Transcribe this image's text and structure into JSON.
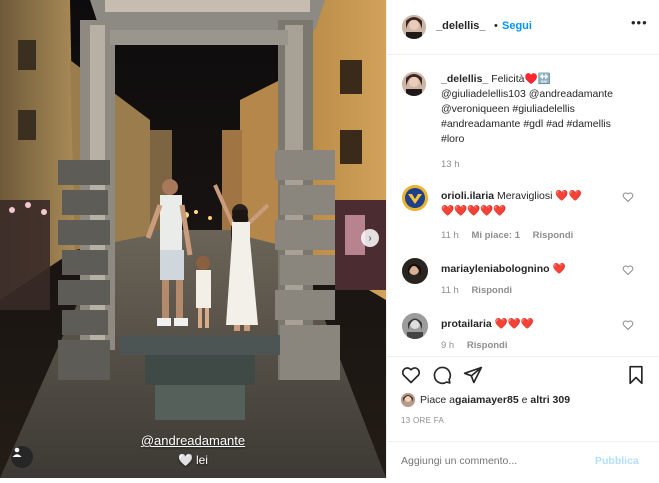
{
  "post": {
    "author": "_delellis_",
    "follow_label": "Segui",
    "dot": "•",
    "more_label": "•••"
  },
  "photo": {
    "overlay_mention": "@andreadamante",
    "overlay_heart": "🤍",
    "overlay_lei": "lei",
    "next_arrow": "›"
  },
  "caption": {
    "author": "_delellis_",
    "line1_text": " Felicità♥️🔛",
    "line2": "@giuliadelellis103 @andreadamante",
    "line3": "@veroniqueen #giuliadelellis",
    "line4": "#andreadamante #gdl #ad #damellis",
    "line5": "#loro",
    "time": "13 h"
  },
  "comments": [
    {
      "user": "orioli.ilaria",
      "text": " Meravigliosi ❤️❤️",
      "text2": "❤️❤️❤️❤️❤️",
      "time": "11 h",
      "likes": "Mi piace: 1",
      "reply": "Rispondi"
    },
    {
      "user": "mariaylenia bolognino",
      "user_display": "mariayleniabolognino",
      "text": " ❤️",
      "time": "11 h",
      "reply": "Rispondi"
    },
    {
      "user": "protailaria",
      "text": " ❤️❤️❤️",
      "time": "9 h",
      "reply": "Rispondi"
    }
  ],
  "likes": {
    "prefix": "Piace a ",
    "user": "gaiamayer85",
    "mid": " e ",
    "others": "altri 309"
  },
  "posted": "13 ORE FA",
  "add_comment": {
    "placeholder": "Aggiungi un commento...",
    "post_label": "Pubblica"
  },
  "colors": {
    "accent": "#0095f6",
    "publish_disabled": "#b2dffc",
    "heart": "#e0245e",
    "muted": "#8e8e8e"
  },
  "icons": [
    "heart-icon",
    "comment-icon",
    "share-icon",
    "bookmark-icon",
    "more-icon",
    "user-tag-icon",
    "like-heart-icon",
    "chevron-right-icon"
  ]
}
